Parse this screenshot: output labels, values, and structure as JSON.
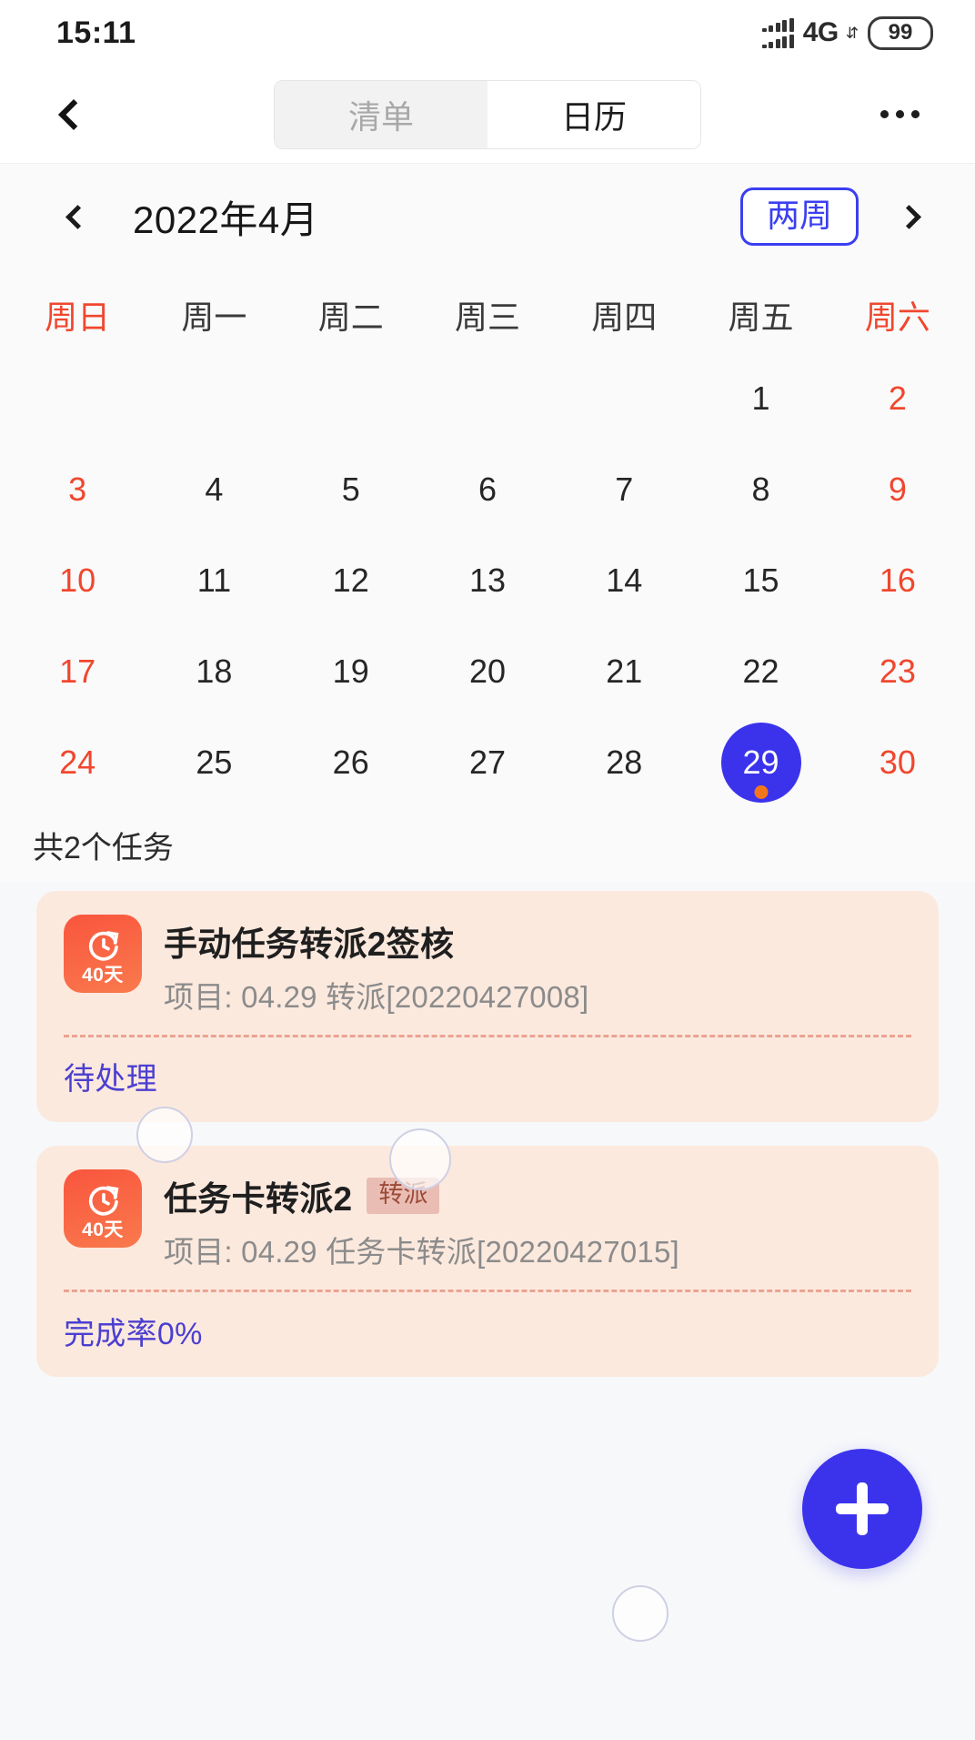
{
  "status_bar": {
    "time": "15:11",
    "network": "4G",
    "network_arrows": "⇵",
    "battery": "99",
    "signal_icon": "signal-bars-icon"
  },
  "nav": {
    "back_icon": "back-chevron-icon",
    "more_icon": "more-options-icon",
    "segments": [
      {
        "label": "清单",
        "active": false
      },
      {
        "label": "日历",
        "active": true
      }
    ]
  },
  "calendar": {
    "prev_icon": "chevron-left-icon",
    "next_icon": "chevron-right-icon",
    "title": "2022年4月",
    "range_button": "两周",
    "weekdays": [
      {
        "label": "周日",
        "weekend": true
      },
      {
        "label": "周一",
        "weekend": false
      },
      {
        "label": "周二",
        "weekend": false
      },
      {
        "label": "周三",
        "weekend": false
      },
      {
        "label": "周四",
        "weekend": false
      },
      {
        "label": "周五",
        "weekend": false
      },
      {
        "label": "周六",
        "weekend": true
      }
    ],
    "weeks": [
      [
        "",
        "",
        "",
        "",
        "",
        "1",
        "2"
      ],
      [
        "3",
        "4",
        "5",
        "6",
        "7",
        "8",
        "9"
      ],
      [
        "10",
        "11",
        "12",
        "13",
        "14",
        "15",
        "16"
      ],
      [
        "17",
        "18",
        "19",
        "20",
        "21",
        "22",
        "23"
      ],
      [
        "24",
        "25",
        "26",
        "27",
        "28",
        "29",
        "30"
      ]
    ],
    "selected_day": "29",
    "selected_has_dot": true,
    "selected_bg_color": "#3b33ec",
    "dot_color": "#f4761c",
    "weekend_color": "#f0472e",
    "summary": "共2个任务"
  },
  "tasks": [
    {
      "icon_name": "refresh-clock-icon",
      "icon_days": "40天",
      "title": "手动任务转派2签核",
      "badge": "",
      "subtitle": "项目: 04.29 转派[20220427008]",
      "status": "待处理"
    },
    {
      "icon_name": "refresh-clock-icon",
      "icon_days": "40天",
      "title": "任务卡转派2",
      "badge": "转派",
      "subtitle": "项目: 04.29 任务卡转派[20220427015]",
      "status": "完成率0%"
    }
  ],
  "fab": {
    "icon": "plus-icon",
    "color": "#3b33ec"
  }
}
